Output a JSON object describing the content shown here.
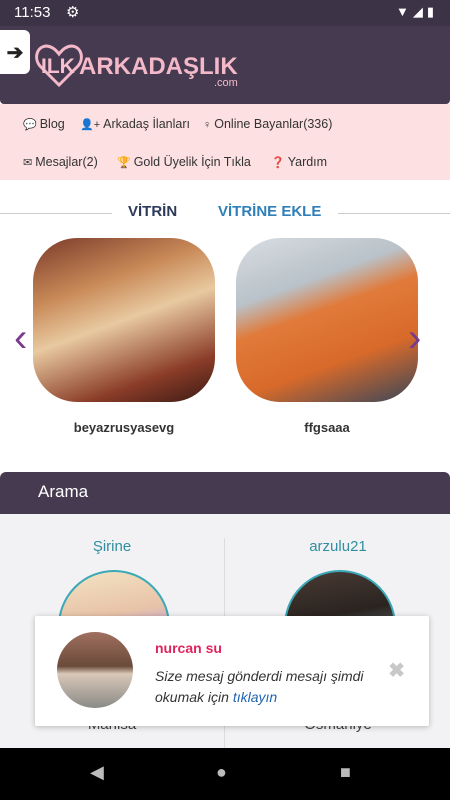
{
  "status": {
    "time": "11:53",
    "settings_icon": "gear-icon",
    "system_icons": "wifi-icon signal-icon battery-icon"
  },
  "header": {
    "logo_ilk": "ILK",
    "logo_rest": "ARKADAŞLIK",
    "logo_com": ".com",
    "exit_icon": "arrow-right-icon"
  },
  "nav": {
    "items": [
      {
        "label": "Blog",
        "icon": "comment-icon"
      },
      {
        "label": "Arkadaş İlanları",
        "icon": "user-plus-icon"
      },
      {
        "label": "Online Bayanlar(336)",
        "icon": "female-icon"
      },
      {
        "label": "Mesajlar(2)",
        "icon": "envelope-icon"
      },
      {
        "label": "Gold Üyelik İçin Tıkla",
        "icon": "trophy-icon"
      },
      {
        "label": "Yardım",
        "icon": "question-icon"
      }
    ]
  },
  "vitrin": {
    "tab_vitrin": "VİTRİN",
    "tab_ekle": "VİTRİNE EKLE",
    "cards": [
      {
        "username": "beyazrusyasevg"
      },
      {
        "username": "ffgsaaa"
      }
    ]
  },
  "arama": {
    "title": "Arama"
  },
  "results": [
    {
      "name": "Şirine",
      "city": "Manisa"
    },
    {
      "name": "arzulu21",
      "city": "Osmaniye"
    }
  ],
  "notification": {
    "name": "nurcan su",
    "text": "Size mesaj gönderdi mesajı şimdi okumak için",
    "link": "tıklayın",
    "close": "✖"
  },
  "colors": {
    "header": "#463a50",
    "nav_bg": "#fde0e2",
    "accent_blue": "#2f7fb8",
    "accent_pink": "#e0245e"
  }
}
